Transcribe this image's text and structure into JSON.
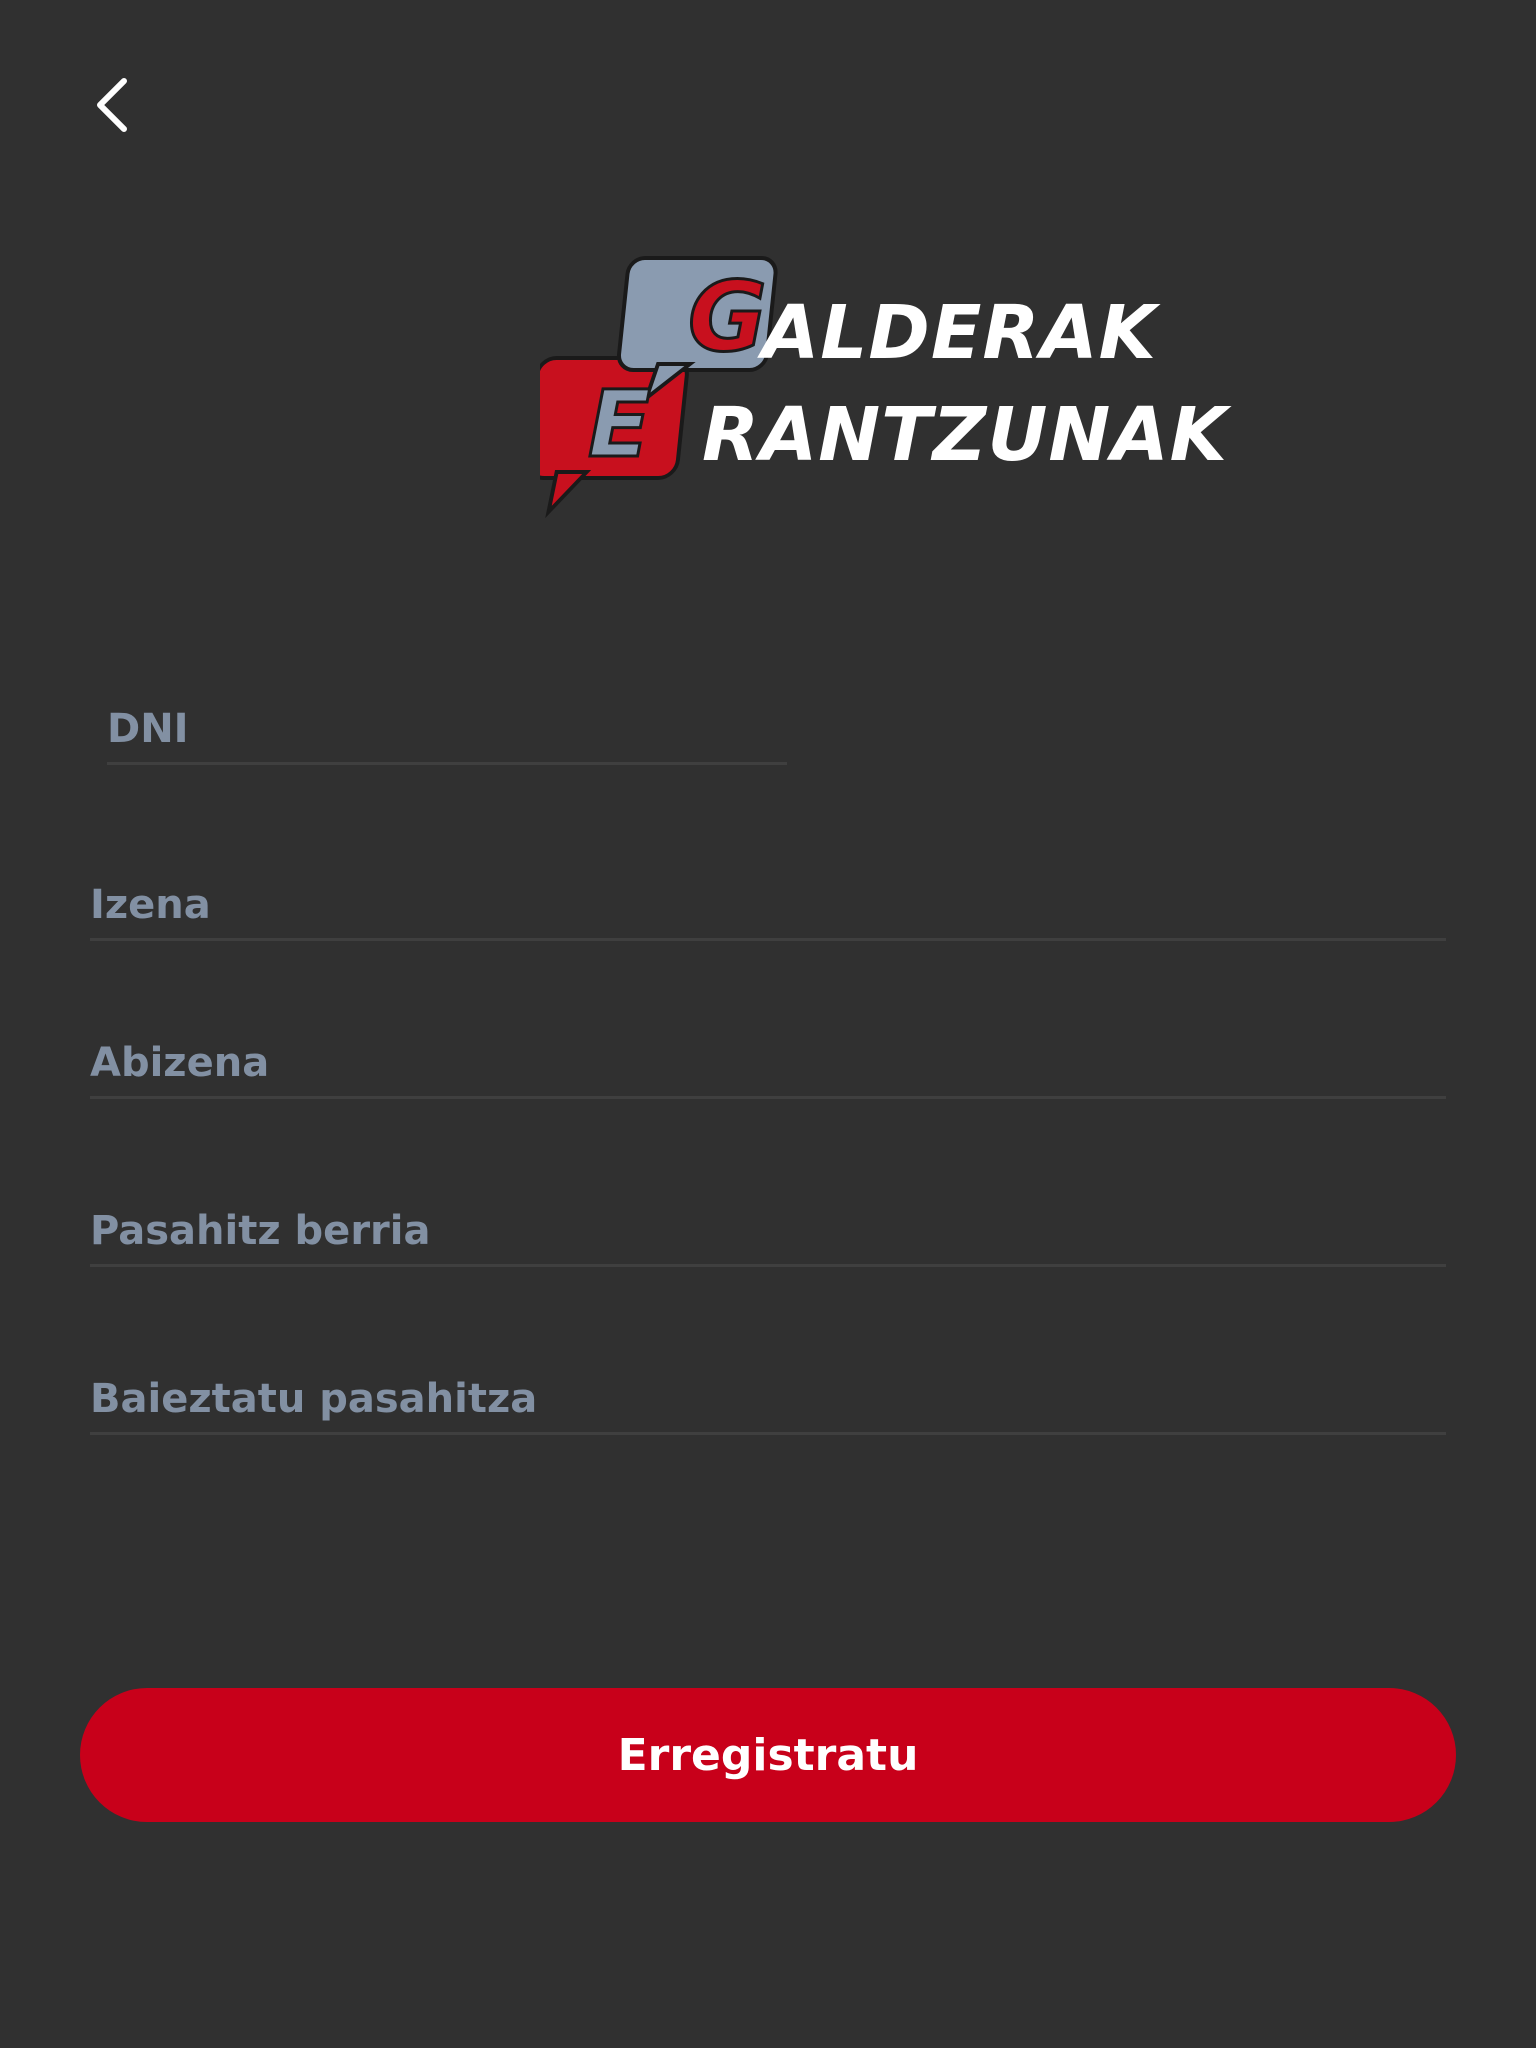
{
  "header": {
    "back_icon": "chevron-left-icon"
  },
  "logo": {
    "letter_g": "G",
    "letter_e": "E",
    "word_top": "ALDERAK",
    "word_bottom": "RANTZUNAK",
    "colors": {
      "red": "#c8101e",
      "gray_blue": "#8a9bb0",
      "white": "#ffffff"
    }
  },
  "form": {
    "dni": {
      "placeholder": "DNI",
      "value": ""
    },
    "izena": {
      "placeholder": "Izena",
      "value": ""
    },
    "abizena": {
      "placeholder": "Abizena",
      "value": ""
    },
    "pasahitz_berria": {
      "placeholder": "Pasahitz berria",
      "value": ""
    },
    "baieztatu_pasahitza": {
      "placeholder": "Baieztatu pasahitza",
      "value": ""
    }
  },
  "actions": {
    "register_label": "Erregistratu"
  },
  "colors": {
    "background": "#303030",
    "accent": "#c8001a",
    "placeholder": "#8290a3",
    "underline": "#3f3f3f"
  }
}
